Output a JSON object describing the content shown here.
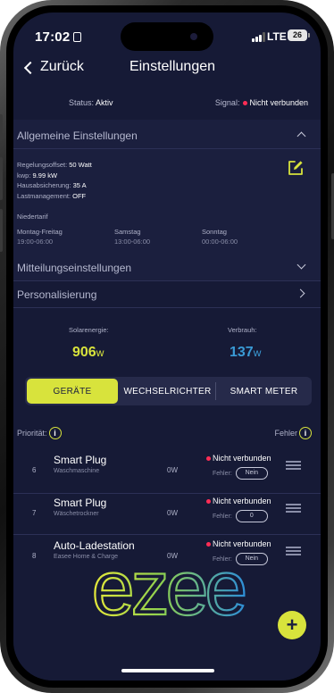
{
  "status_bar": {
    "time": "17:02",
    "network": "LTE",
    "battery": "26"
  },
  "nav": {
    "back_label": "Zurück",
    "title": "Einstellungen"
  },
  "status": {
    "status_label": "Status:",
    "status_value": "Aktiv",
    "signal_label": "Signal:",
    "signal_value": "Nicht verbunden"
  },
  "general": {
    "title": "Allgemeine Einstellungen",
    "rows": [
      {
        "label": "Regelungsoffset:",
        "value": "50 Watt"
      },
      {
        "label": "kwp:",
        "value": "9.99 kW"
      },
      {
        "label": "Hausabsicherung:",
        "value": "35 A"
      },
      {
        "label": "Lastmanagement:",
        "value": "OFF"
      }
    ],
    "niedertarif": "Niedertarif",
    "tariffs": [
      {
        "day": "Montag-Freitag",
        "time": "19:00-06:00"
      },
      {
        "day": "Samstag",
        "time": "13:00-06:00"
      },
      {
        "day": "Sonntag",
        "time": "00:00-06:00"
      }
    ]
  },
  "notifications": {
    "title": "Mitteilungseinstellungen"
  },
  "personalization": {
    "title": "Personalisierung"
  },
  "energy": {
    "solar_label": "Solarenergie:",
    "solar_value": "906",
    "consumption_label": "Verbrauh:",
    "consumption_value": "137",
    "unit": "w"
  },
  "tabs": [
    {
      "label": "GERÄTE",
      "active": true
    },
    {
      "label": "WECHSELRICHTER",
      "active": false
    },
    {
      "label": "SMART METER",
      "active": false
    }
  ],
  "list_header": {
    "priority_label": "Priorität:",
    "error_label": "Fehler"
  },
  "devices": [
    {
      "num": "6",
      "name": "Smart Plug",
      "sub": "Waschmaschine",
      "watt": "0W",
      "status": "Nicht verbunden",
      "error_label": "Fehler:",
      "error_value": "Nein"
    },
    {
      "num": "7",
      "name": "Smart Plug",
      "sub": "Wäschetrockner",
      "watt": "0W",
      "status": "Nicht verbunden",
      "error_label": "Fehler:",
      "error_value": "0"
    },
    {
      "num": "8",
      "name": "Auto-Ladestation",
      "sub": "Easee Home & Charge",
      "watt": "0W",
      "status": "Nicht verbunden",
      "error_label": "Fehler:",
      "error_value": "Nein"
    }
  ],
  "logo": {
    "text": "ezee"
  },
  "fab": {
    "label": "+"
  },
  "colors": {
    "accent": "#d8e33c",
    "background": "#161a36",
    "error": "#ff2d55",
    "consumption": "#3a9bd6"
  }
}
